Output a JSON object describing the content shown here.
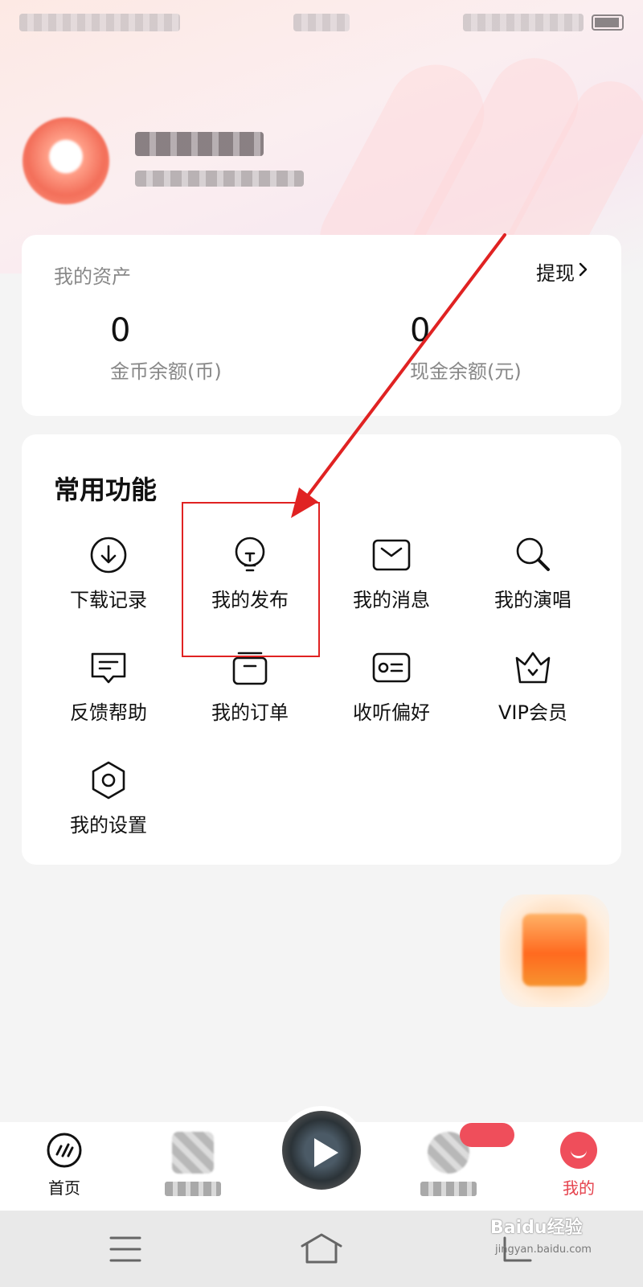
{
  "assets": {
    "title": "我的资产",
    "withdraw_label": "提现",
    "coin": {
      "value": "0",
      "label": "金币余额(币)"
    },
    "cash": {
      "value": "0",
      "label": "现金余额(元)"
    }
  },
  "functions": {
    "title": "常用功能",
    "items": [
      {
        "label": "下载记录",
        "icon": "download-icon"
      },
      {
        "label": "我的发布",
        "icon": "bulb-icon"
      },
      {
        "label": "我的消息",
        "icon": "mail-icon"
      },
      {
        "label": "我的演唱",
        "icon": "search-icon"
      },
      {
        "label": "反馈帮助",
        "icon": "feedback-icon"
      },
      {
        "label": "我的订单",
        "icon": "order-icon"
      },
      {
        "label": "收听偏好",
        "icon": "preference-icon"
      },
      {
        "label": "VIP会员",
        "icon": "crown-icon"
      },
      {
        "label": "我的设置",
        "icon": "settings-icon"
      }
    ]
  },
  "tabs": {
    "home": "首页",
    "mine": "我的"
  },
  "colors": {
    "accent": "#ef4e5b",
    "annotation": "#e02222"
  },
  "watermark": {
    "brand": "Baidu经验",
    "url": "jingyan.baidu.com"
  }
}
